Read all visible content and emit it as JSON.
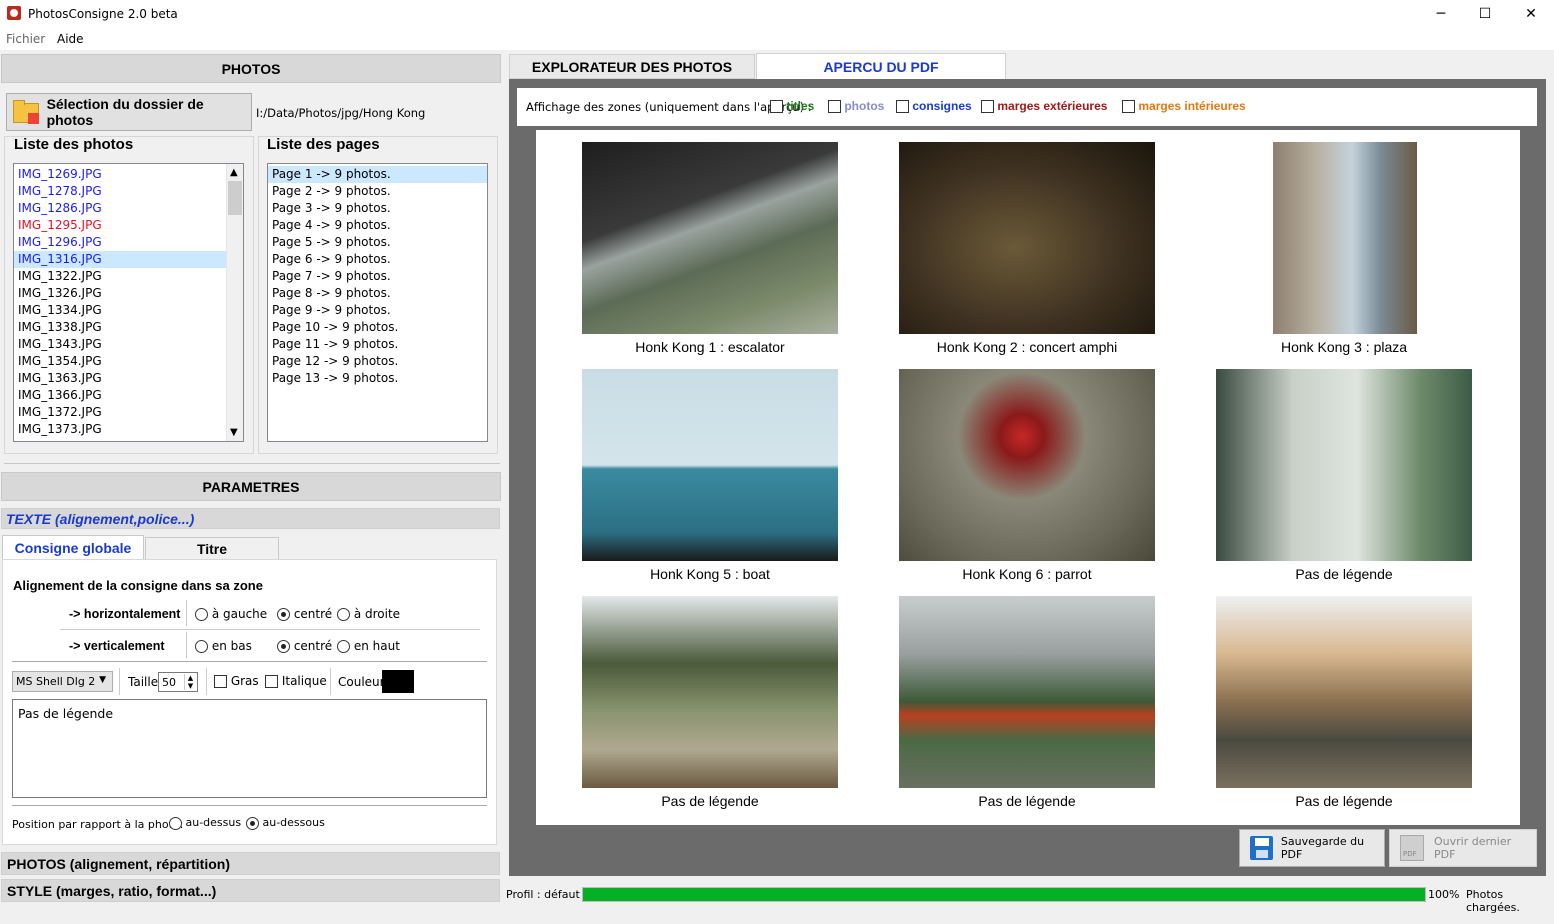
{
  "window": {
    "title": "PhotosConsigne 2.0 beta",
    "minimize": "─",
    "maximize": "☐",
    "close": "✕"
  },
  "menu": {
    "fichier": "Fichier",
    "aide": "Aide"
  },
  "photos_section": {
    "header": "PHOTOS",
    "select_button": "Sélection du dossier de photos",
    "folder_path": "I:/Data/Photos/jpg/Hong Kong",
    "photo_list_title": "Liste des photos",
    "page_list_title": "Liste des pages",
    "photo_list": [
      {
        "name": "IMG_1269.JPG",
        "color": "#1a1aff"
      },
      {
        "name": "IMG_1278.JPG",
        "color": "#1a1aff"
      },
      {
        "name": "IMG_1286.JPG",
        "color": "#1a1aff"
      },
      {
        "name": "IMG_1295.JPG",
        "color": "#e81123"
      },
      {
        "name": "IMG_1296.JPG",
        "color": "#1a1aff"
      },
      {
        "name": "IMG_1316.JPG",
        "color": "#1a1aff"
      },
      {
        "name": "IMG_1322.JPG",
        "color": "#000000"
      },
      {
        "name": "IMG_1326.JPG",
        "color": "#000000"
      },
      {
        "name": "IMG_1334.JPG",
        "color": "#000000"
      },
      {
        "name": "IMG_1338.JPG",
        "color": "#000000"
      },
      {
        "name": "IMG_1343.JPG",
        "color": "#000000"
      },
      {
        "name": "IMG_1354.JPG",
        "color": "#000000"
      },
      {
        "name": "IMG_1363.JPG",
        "color": "#000000"
      },
      {
        "name": "IMG_1366.JPG",
        "color": "#000000"
      },
      {
        "name": "IMG_1372.JPG",
        "color": "#000000"
      },
      {
        "name": "IMG_1373.JPG",
        "color": "#000000"
      }
    ],
    "page_list": [
      "Page 1 -> 9 photos.",
      "Page 2 -> 9 photos.",
      "Page 3 -> 9 photos.",
      "Page 4 -> 9 photos.",
      "Page 5 -> 9 photos.",
      "Page 6 -> 9 photos.",
      "Page 7 -> 9 photos.",
      "Page 8 -> 9 photos.",
      "Page 9 -> 9 photos.",
      "Page 10 -> 9 photos.",
      "Page 11 -> 9 photos.",
      "Page 12 -> 9 photos.",
      "Page 13 -> 9 photos."
    ]
  },
  "params": {
    "header": "PARAMETRES",
    "texte_section": "TEXTE (alignement,police...)",
    "tab_global": "Consigne globale",
    "tab_titre": "Titre",
    "alignment_title": "Alignement de la consigne dans sa zone",
    "horizontal_label": "-> horizontalement",
    "vertical_label": "-> verticalement",
    "h_options": [
      "à gauche",
      "centré",
      "à droite"
    ],
    "v_options": [
      "en bas",
      "centré",
      "en haut"
    ],
    "font_name": "MS Shell Dlg 2",
    "size_label": "Taille",
    "size_value": "50",
    "bold_label": "Gras",
    "italic_label": "Italique",
    "color_label": "Couleur",
    "text_value": "Pas de légende",
    "position_label": "Position par rapport à la photo:",
    "pos_options": [
      "au-dessus",
      "au-dessous"
    ],
    "photos_section": "PHOTOS (alignement, répartition)",
    "style_section": "STYLE (marges, ratio, format...)"
  },
  "tabs": {
    "explorer": "EXPLORATEUR DES PHOTOS",
    "preview": "APERCU DU PDF"
  },
  "zones": {
    "label": "Affichage des zones (uniquement dans l'aperçu) :",
    "titles": "titles",
    "photos": "photos",
    "consignes": "consignes",
    "ext": "marges extérieures",
    "int": "marges intérieures"
  },
  "captions": [
    "Honk Kong 1 : escalator",
    "Honk Kong 2 : concert amphi",
    "Honk Kong 3 : plaza",
    "Honk Kong 5 : boat",
    "Honk Kong 6 : parrot",
    "Pas de légende",
    "Pas de légende",
    "Pas de légende",
    "Pas de légende"
  ],
  "buttons": {
    "save_pdf": "Sauvegarde du PDF",
    "open_pdf": "Ouvrir dernier PDF"
  },
  "status": {
    "profile": "Profil :  défaut",
    "progress_percent": 100,
    "progress_text": "100%",
    "message": "Photos chargées."
  }
}
